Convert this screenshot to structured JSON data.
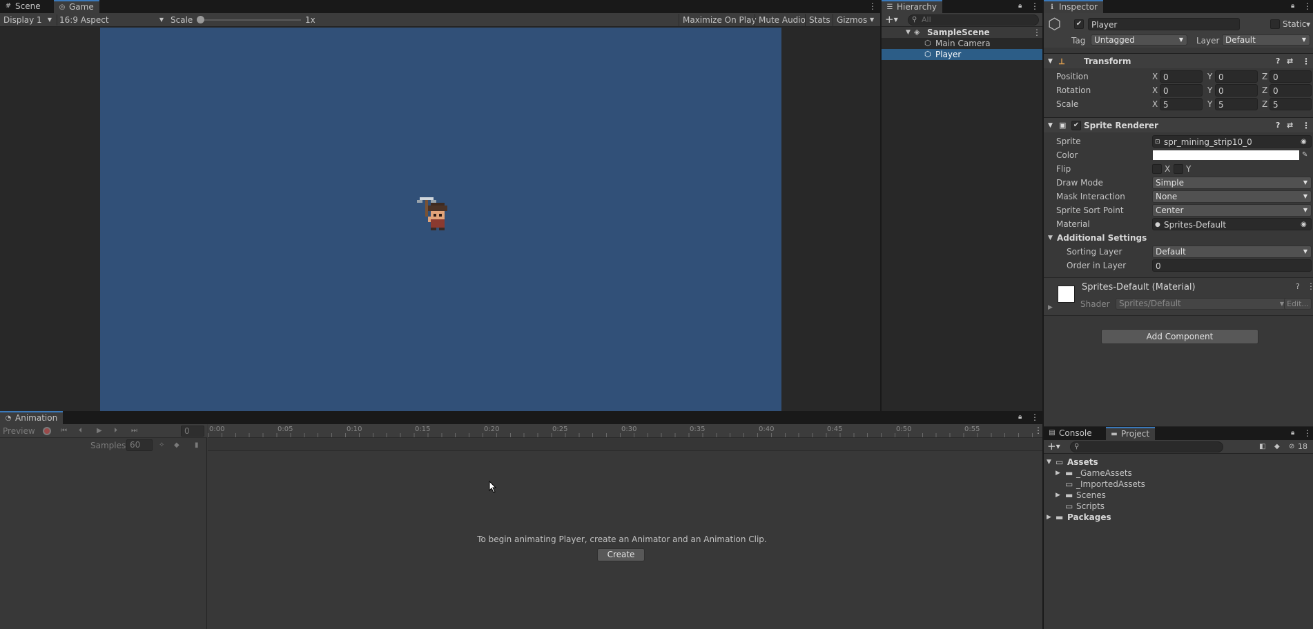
{
  "game_panel": {
    "tabs": [
      "Scene",
      "Game"
    ],
    "display": "Display 1",
    "aspect": "16:9 Aspect",
    "scale_label": "Scale",
    "scale_value": "1x",
    "scale_level": 0.0,
    "buttons": [
      "Maximize On Play",
      "Mute Audio",
      "Stats",
      "Gizmos"
    ],
    "viewport_color": "#315078"
  },
  "hierarchy": {
    "title": "Hierarchy",
    "search_placeholder": "All",
    "scene": "SampleScene",
    "items": [
      "Main Camera",
      "Player"
    ]
  },
  "inspector": {
    "title": "Inspector",
    "object_name": "Player",
    "static_label": "Static",
    "tag_label": "Tag",
    "tag_value": "Untagged",
    "layer_label": "Layer",
    "layer_value": "Default",
    "transform": {
      "title": "Transform",
      "rows": [
        {
          "label": "Position",
          "x": "0",
          "y": "0",
          "z": "0"
        },
        {
          "label": "Rotation",
          "x": "0",
          "y": "0",
          "z": "0"
        },
        {
          "label": "Scale",
          "x": "5",
          "y": "5",
          "z": "5"
        }
      ],
      "axis": [
        "X",
        "Y",
        "Z"
      ]
    },
    "sprite_renderer": {
      "title": "Sprite Renderer",
      "sprite_label": "Sprite",
      "sprite_value": "spr_mining_strip10_0",
      "color_label": "Color",
      "color_value": "#FFFFFF",
      "flip_label": "Flip",
      "flip_x": "X",
      "flip_y": "Y",
      "draw_mode_label": "Draw Mode",
      "draw_mode": "Simple",
      "mask_label": "Mask Interaction",
      "mask": "None",
      "sort_point_label": "Sprite Sort Point",
      "sort_point": "Center",
      "material_label": "Material",
      "material": "Sprites-Default",
      "additional": "Additional Settings",
      "sorting_layer_label": "Sorting Layer",
      "sorting_layer": "Default",
      "order_label": "Order in Layer",
      "order": "0"
    },
    "material": {
      "title": "Sprites-Default (Material)",
      "shader_label": "Shader",
      "shader": "Sprites/Default",
      "edit": "Edit..."
    },
    "add_component": "Add Component"
  },
  "animation": {
    "title": "Animation",
    "preview": "Preview",
    "frame": "0",
    "samples_label": "Samples",
    "samples": "60",
    "ticks": [
      "0:00",
      "0:05",
      "0:10",
      "0:15",
      "0:20",
      "0:25",
      "0:30",
      "0:35",
      "0:40",
      "0:45",
      "0:50",
      "0:55"
    ],
    "message": "To begin animating Player, create an Animator and an Animation Clip.",
    "create": "Create"
  },
  "project": {
    "tabs": [
      "Console",
      "Project"
    ],
    "hidden_count": "18",
    "tree": [
      {
        "label": "Assets",
        "bold": true
      },
      {
        "label": "_GameAssets"
      },
      {
        "label": "_ImportedAssets"
      },
      {
        "label": "Scenes"
      },
      {
        "label": "Scripts"
      },
      {
        "label": "Packages",
        "bold": true
      }
    ]
  }
}
